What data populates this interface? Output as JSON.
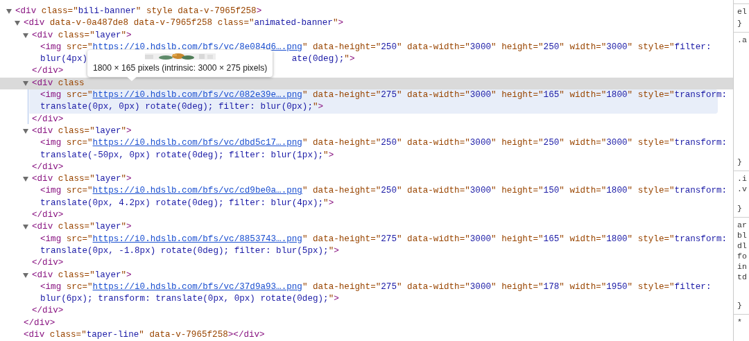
{
  "elements_tree": {
    "nodes": [
      {
        "expanded": true,
        "selected": false,
        "open": [
          {
            "kind": "tag",
            "text": "<div"
          },
          {
            "kind": "attr",
            "text": " class=\""
          },
          {
            "kind": "val",
            "text": "bili-banner"
          },
          {
            "kind": "attr",
            "text": "\" style data-v-7965f258"
          },
          {
            "kind": "tag",
            "text": ">"
          }
        ],
        "children": [
          {
            "expanded": true,
            "selected": false,
            "open": [
              {
                "kind": "tag",
                "text": "<div"
              },
              {
                "kind": "attr",
                "text": " data-v-0a487de8 data-v-7965f258 class=\""
              },
              {
                "kind": "val",
                "text": "animated-banner"
              },
              {
                "kind": "attr",
                "text": "\""
              },
              {
                "kind": "tag",
                "text": ">"
              }
            ],
            "children": [
              {
                "expanded": true,
                "selected": false,
                "open": [
                  {
                    "kind": "tag",
                    "text": "<div"
                  },
                  {
                    "kind": "attr",
                    "text": " class=\""
                  },
                  {
                    "kind": "val",
                    "text": "layer"
                  },
                  {
                    "kind": "attr",
                    "text": "\""
                  },
                  {
                    "kind": "tag",
                    "text": ">"
                  }
                ],
                "children": [
                  {
                    "lines": [
                      [
                        {
                          "kind": "tag",
                          "text": "<img"
                        },
                        {
                          "kind": "attr",
                          "text": " src=\""
                        },
                        {
                          "kind": "link",
                          "text": "https://i0.hdslb.com/bfs/vc/8e084d6….png"
                        },
                        {
                          "kind": "attr",
                          "text": "\" data-height=\""
                        },
                        {
                          "kind": "val",
                          "text": "250"
                        },
                        {
                          "kind": "attr",
                          "text": "\" data-width=\""
                        },
                        {
                          "kind": "val",
                          "text": "3000"
                        },
                        {
                          "kind": "attr",
                          "text": "\" height=\""
                        },
                        {
                          "kind": "val",
                          "text": "250"
                        },
                        {
                          "kind": "attr",
                          "text": "\" width=\""
                        },
                        {
                          "kind": "val",
                          "text": "3000"
                        },
                        {
                          "kind": "attr",
                          "text": "\" style=\""
                        },
                        {
                          "kind": "val",
                          "text": "filter:"
                        }
                      ],
                      [
                        {
                          "kind": "val",
                          "text": "blur(4px)"
                        },
                        {
                          "kind": "covered"
                        },
                        {
                          "kind": "val",
                          "text": "ate(0deg);"
                        },
                        {
                          "kind": "attr",
                          "text": "\""
                        },
                        {
                          "kind": "tag",
                          "text": ">"
                        }
                      ]
                    ]
                  }
                ],
                "close": [
                  {
                    "kind": "tag",
                    "text": "</div>"
                  }
                ]
              },
              {
                "expanded": true,
                "selected": true,
                "open": [
                  {
                    "kind": "tag",
                    "text": "<div"
                  },
                  {
                    "kind": "attr",
                    "text": " class"
                  }
                ],
                "children": [
                  {
                    "lines": [
                      [
                        {
                          "kind": "tag",
                          "text": "<img"
                        },
                        {
                          "kind": "attr",
                          "text": " src=\""
                        },
                        {
                          "kind": "link",
                          "text": "https://i0.hdslb.com/bfs/vc/082e39e….png"
                        },
                        {
                          "kind": "attr",
                          "text": "\" data-height=\""
                        },
                        {
                          "kind": "val",
                          "text": "275"
                        },
                        {
                          "kind": "attr",
                          "text": "\" data-width=\""
                        },
                        {
                          "kind": "val",
                          "text": "3000"
                        },
                        {
                          "kind": "attr",
                          "text": "\" height=\""
                        },
                        {
                          "kind": "val",
                          "text": "165"
                        },
                        {
                          "kind": "attr",
                          "text": "\" width=\""
                        },
                        {
                          "kind": "val",
                          "text": "1800"
                        },
                        {
                          "kind": "attr",
                          "text": "\" style=\""
                        },
                        {
                          "kind": "val",
                          "text": "transform:"
                        }
                      ],
                      [
                        {
                          "kind": "val",
                          "text": "translate(0px, 0px) rotate(0deg); filter: blur(0px);"
                        },
                        {
                          "kind": "attr",
                          "text": "\""
                        },
                        {
                          "kind": "tag",
                          "text": ">"
                        }
                      ]
                    ]
                  }
                ],
                "close": [
                  {
                    "kind": "tag",
                    "text": "</div>"
                  }
                ]
              },
              {
                "expanded": true,
                "selected": false,
                "open": [
                  {
                    "kind": "tag",
                    "text": "<div"
                  },
                  {
                    "kind": "attr",
                    "text": " class=\""
                  },
                  {
                    "kind": "val",
                    "text": "layer"
                  },
                  {
                    "kind": "attr",
                    "text": "\""
                  },
                  {
                    "kind": "tag",
                    "text": ">"
                  }
                ],
                "children": [
                  {
                    "lines": [
                      [
                        {
                          "kind": "tag",
                          "text": "<img"
                        },
                        {
                          "kind": "attr",
                          "text": " src=\""
                        },
                        {
                          "kind": "link",
                          "text": "https://i0.hdslb.com/bfs/vc/dbd5c17….png"
                        },
                        {
                          "kind": "attr",
                          "text": "\" data-height=\""
                        },
                        {
                          "kind": "val",
                          "text": "250"
                        },
                        {
                          "kind": "attr",
                          "text": "\" data-width=\""
                        },
                        {
                          "kind": "val",
                          "text": "3000"
                        },
                        {
                          "kind": "attr",
                          "text": "\" height=\""
                        },
                        {
                          "kind": "val",
                          "text": "250"
                        },
                        {
                          "kind": "attr",
                          "text": "\" width=\""
                        },
                        {
                          "kind": "val",
                          "text": "3000"
                        },
                        {
                          "kind": "attr",
                          "text": "\" style=\""
                        },
                        {
                          "kind": "val",
                          "text": "transform:"
                        }
                      ],
                      [
                        {
                          "kind": "val",
                          "text": "translate(-50px, 0px) rotate(0deg); filter: blur(1px);"
                        },
                        {
                          "kind": "attr",
                          "text": "\""
                        },
                        {
                          "kind": "tag",
                          "text": ">"
                        }
                      ]
                    ]
                  }
                ],
                "close": [
                  {
                    "kind": "tag",
                    "text": "</div>"
                  }
                ]
              },
              {
                "expanded": true,
                "selected": false,
                "open": [
                  {
                    "kind": "tag",
                    "text": "<div"
                  },
                  {
                    "kind": "attr",
                    "text": " class=\""
                  },
                  {
                    "kind": "val",
                    "text": "layer"
                  },
                  {
                    "kind": "attr",
                    "text": "\""
                  },
                  {
                    "kind": "tag",
                    "text": ">"
                  }
                ],
                "children": [
                  {
                    "lines": [
                      [
                        {
                          "kind": "tag",
                          "text": "<img"
                        },
                        {
                          "kind": "attr",
                          "text": " src=\""
                        },
                        {
                          "kind": "link",
                          "text": "https://i0.hdslb.com/bfs/vc/cd9be0a….png"
                        },
                        {
                          "kind": "attr",
                          "text": "\" data-height=\""
                        },
                        {
                          "kind": "val",
                          "text": "250"
                        },
                        {
                          "kind": "attr",
                          "text": "\" data-width=\""
                        },
                        {
                          "kind": "val",
                          "text": "3000"
                        },
                        {
                          "kind": "attr",
                          "text": "\" height=\""
                        },
                        {
                          "kind": "val",
                          "text": "150"
                        },
                        {
                          "kind": "attr",
                          "text": "\" width=\""
                        },
                        {
                          "kind": "val",
                          "text": "1800"
                        },
                        {
                          "kind": "attr",
                          "text": "\" style=\""
                        },
                        {
                          "kind": "val",
                          "text": "transform:"
                        }
                      ],
                      [
                        {
                          "kind": "val",
                          "text": "translate(0px, 4.2px) rotate(0deg); filter: blur(4px);"
                        },
                        {
                          "kind": "attr",
                          "text": "\""
                        },
                        {
                          "kind": "tag",
                          "text": ">"
                        }
                      ]
                    ]
                  }
                ],
                "close": [
                  {
                    "kind": "tag",
                    "text": "</div>"
                  }
                ]
              },
              {
                "expanded": true,
                "selected": false,
                "open": [
                  {
                    "kind": "tag",
                    "text": "<div"
                  },
                  {
                    "kind": "attr",
                    "text": " class=\""
                  },
                  {
                    "kind": "val",
                    "text": "layer"
                  },
                  {
                    "kind": "attr",
                    "text": "\""
                  },
                  {
                    "kind": "tag",
                    "text": ">"
                  }
                ],
                "children": [
                  {
                    "lines": [
                      [
                        {
                          "kind": "tag",
                          "text": "<img"
                        },
                        {
                          "kind": "attr",
                          "text": " src=\""
                        },
                        {
                          "kind": "link",
                          "text": "https://i0.hdslb.com/bfs/vc/8853743….png"
                        },
                        {
                          "kind": "attr",
                          "text": "\" data-height=\""
                        },
                        {
                          "kind": "val",
                          "text": "275"
                        },
                        {
                          "kind": "attr",
                          "text": "\" data-width=\""
                        },
                        {
                          "kind": "val",
                          "text": "3000"
                        },
                        {
                          "kind": "attr",
                          "text": "\" height=\""
                        },
                        {
                          "kind": "val",
                          "text": "165"
                        },
                        {
                          "kind": "attr",
                          "text": "\" width=\""
                        },
                        {
                          "kind": "val",
                          "text": "1800"
                        },
                        {
                          "kind": "attr",
                          "text": "\" style=\""
                        },
                        {
                          "kind": "val",
                          "text": "transform:"
                        }
                      ],
                      [
                        {
                          "kind": "val",
                          "text": "translate(0px, -1.8px) rotate(0deg); filter: blur(5px);"
                        },
                        {
                          "kind": "attr",
                          "text": "\""
                        },
                        {
                          "kind": "tag",
                          "text": ">"
                        }
                      ]
                    ]
                  }
                ],
                "close": [
                  {
                    "kind": "tag",
                    "text": "</div>"
                  }
                ]
              },
              {
                "expanded": true,
                "selected": false,
                "open": [
                  {
                    "kind": "tag",
                    "text": "<div"
                  },
                  {
                    "kind": "attr",
                    "text": " class=\""
                  },
                  {
                    "kind": "val",
                    "text": "layer"
                  },
                  {
                    "kind": "attr",
                    "text": "\""
                  },
                  {
                    "kind": "tag",
                    "text": ">"
                  }
                ],
                "children": [
                  {
                    "lines": [
                      [
                        {
                          "kind": "tag",
                          "text": "<img"
                        },
                        {
                          "kind": "attr",
                          "text": " src=\""
                        },
                        {
                          "kind": "link",
                          "text": "https://i0.hdslb.com/bfs/vc/37d9a93….png"
                        },
                        {
                          "kind": "attr",
                          "text": "\" data-height=\""
                        },
                        {
                          "kind": "val",
                          "text": "275"
                        },
                        {
                          "kind": "attr",
                          "text": "\" data-width=\""
                        },
                        {
                          "kind": "val",
                          "text": "3000"
                        },
                        {
                          "kind": "attr",
                          "text": "\" height=\""
                        },
                        {
                          "kind": "val",
                          "text": "178"
                        },
                        {
                          "kind": "attr",
                          "text": "\" width=\""
                        },
                        {
                          "kind": "val",
                          "text": "1950"
                        },
                        {
                          "kind": "attr",
                          "text": "\" style=\""
                        },
                        {
                          "kind": "val",
                          "text": "filter:"
                        }
                      ],
                      [
                        {
                          "kind": "val",
                          "text": "blur(6px); transform: translate(0px, 0px) rotate(0deg);"
                        },
                        {
                          "kind": "attr",
                          "text": "\""
                        },
                        {
                          "kind": "tag",
                          "text": ">"
                        }
                      ]
                    ]
                  }
                ],
                "close": [
                  {
                    "kind": "tag",
                    "text": "</div>"
                  }
                ]
              }
            ],
            "close": [
              {
                "kind": "tag",
                "text": "</div>"
              }
            ]
          },
          {
            "lines": [
              [
                {
                  "kind": "tag",
                  "text": "<div"
                },
                {
                  "kind": "attr",
                  "text": " class=\""
                },
                {
                  "kind": "val",
                  "text": "taper-line"
                },
                {
                  "kind": "attr",
                  "text": "\" data-v-7965f258"
                },
                {
                  "kind": "tag",
                  "text": "></div>"
                }
              ]
            ]
          }
        ]
      }
    ]
  },
  "tooltip": {
    "text": "1800 × 165 pixels (intrinsic: 3000 × 275 pixels)"
  },
  "styles_pane": {
    "sections": [
      {
        "lines": [
          "el"
        ],
        "close": "}"
      },
      {
        "lines": [
          ".a"
        ],
        "close": "}"
      },
      {
        "lines": [
          ".i",
          ".v"
        ],
        "close": "}"
      },
      {
        "lines": [
          "ar",
          "bl",
          "dl",
          "fo",
          "in",
          "td"
        ],
        "close": "}"
      },
      {
        "lines": [
          "*"
        ]
      }
    ]
  }
}
